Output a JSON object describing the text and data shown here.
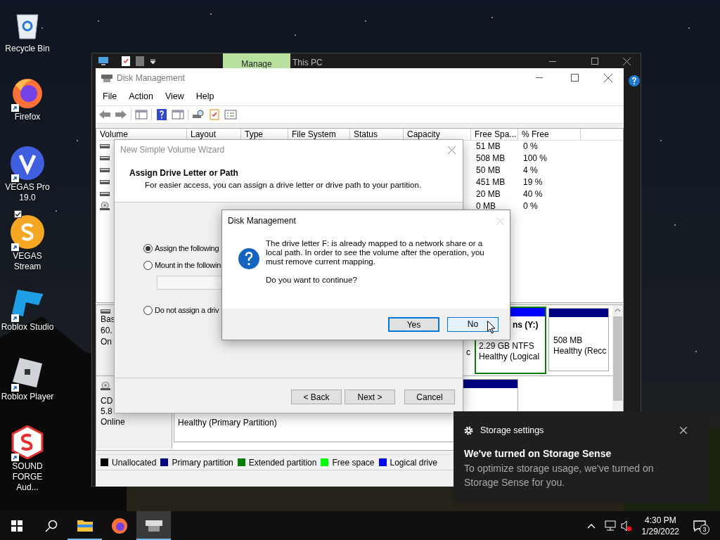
{
  "desktop_icons": [
    {
      "kind": "recycle",
      "label": "Recycle Bin",
      "shortcut": false,
      "checked": false
    },
    {
      "kind": "firefox",
      "label": "Firefox",
      "shortcut": true,
      "checked": false
    },
    {
      "kind": "vegas_pro",
      "label": "VEGAS Pro 19.0",
      "shortcut": true,
      "checked": false
    },
    {
      "kind": "vegas_stream",
      "label": "VEGAS Stream",
      "shortcut": true,
      "checked": true
    },
    {
      "kind": "roblox_studio",
      "label": "Roblox Studio",
      "shortcut": true,
      "checked": false
    },
    {
      "kind": "roblox_player",
      "label": "Roblox Player",
      "shortcut": true,
      "checked": false
    },
    {
      "kind": "sound_forge",
      "label": "SOUND FORGE Aud...",
      "shortcut": true,
      "checked": false
    }
  ],
  "explorer": {
    "tabs": [
      {
        "label": "Manage",
        "selected": true
      },
      {
        "label": "This PC",
        "selected": false
      }
    ]
  },
  "disk_management": {
    "title": "Disk Management",
    "menu": [
      "File",
      "Action",
      "View",
      "Help"
    ],
    "columns": [
      "Volume",
      "Layout",
      "Type",
      "File System",
      "Status",
      "Capacity",
      "Free Spa...",
      "% Free"
    ],
    "rows": [
      {
        "kind": "disk",
        "free_space": "51 MB",
        "percent_free": "0 %"
      },
      {
        "kind": "disk",
        "free_space": "508 MB",
        "percent_free": "100 %"
      },
      {
        "kind": "disk",
        "free_space": "50 MB",
        "percent_free": "4 %"
      },
      {
        "kind": "disk",
        "free_space": "451 MB",
        "percent_free": "19 %"
      },
      {
        "kind": "disk",
        "free_space": "20 MB",
        "percent_free": "40 %"
      },
      {
        "kind": "cd",
        "free_space": "0 MB",
        "percent_free": "0 %"
      }
    ],
    "disks": [
      {
        "kind": "disk",
        "lines": [
          "Bas",
          "60.",
          "On"
        ]
      },
      {
        "kind": "cd",
        "lines": [
          "CD",
          "5.8",
          "Online"
        ]
      }
    ],
    "partitions": {
      "fragment": "c",
      "logical": [
        "ns (Y:)",
        "2.29 GB NTFS",
        "Healthy (Logical"
      ],
      "recovery": [
        "508 MB",
        "Healthy (Recc"
      ],
      "cd": "Healthy (Primary Partition)"
    },
    "legend": [
      {
        "label": "Unallocated",
        "color": "#000000"
      },
      {
        "label": "Primary partition",
        "color": "#000080"
      },
      {
        "label": "Extended partition",
        "color": "#008000"
      },
      {
        "label": "Free space",
        "color": "#00ff00"
      },
      {
        "label": "Logical drive",
        "color": "#0000ff"
      }
    ]
  },
  "wizard": {
    "title": "New Simple Volume Wizard",
    "heading": "Assign Drive Letter or Path",
    "subtitle": "For easier access, you can assign a drive letter or drive path to your partition.",
    "options": [
      {
        "label": "Assign the following",
        "selected": true
      },
      {
        "label": "Mount in the followin",
        "selected": false
      },
      {
        "label": "Do not assign a driv",
        "selected": false
      }
    ],
    "buttons": [
      "< Back",
      "Next >",
      "Cancel"
    ]
  },
  "dialog": {
    "title": "Disk Management",
    "message": "The drive letter F: is already mapped to a network share or a local path. In order to see the volume after the operation, you must remove current mapping.",
    "question": "Do you want to continue?",
    "buttons": [
      {
        "label": "Yes",
        "default": true,
        "hovered": false
      },
      {
        "label": "No",
        "default": false,
        "hovered": true
      }
    ]
  },
  "notification": {
    "header": "Storage settings",
    "title": "We've turned on Storage Sense",
    "body": "To optimize storage usage, we've turned on Storage Sense for you."
  },
  "taskbar": {
    "apps": [
      {
        "kind": "explorer",
        "running": true,
        "active": false
      },
      {
        "kind": "firefox",
        "running": false,
        "active": false
      },
      {
        "kind": "diskmgmt",
        "running": true,
        "active": true
      }
    ],
    "time": "4:30 PM",
    "date": "1/29/2022",
    "notification_count": "3"
  }
}
